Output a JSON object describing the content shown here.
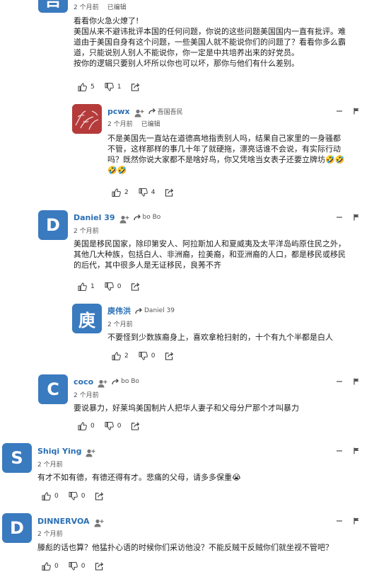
{
  "comments": [
    {
      "avatar_letter": "吾",
      "time": "2 个月前",
      "edited": "已编辑",
      "lines": [
        "看看你火急火燎了!",
        "美国从来不避讳批评本国的任何问题，你说的这些问题美国国内一直有批评。难",
        "道由于美国自身有这个问题，一些美国人就不能说你们的问题了？看看你多么霸",
        "道，只能说别人别人不能说你，你一定是中共培养出来的好党员。",
        "按你的逻辑只要别人坏所以你也可以坏，那你与他们有什么差别。"
      ],
      "likes": "5",
      "dislikes": "1"
    },
    {
      "author": "pcwx",
      "reply_to": "吾国吾民",
      "time": "2 个月前",
      "edited": "已编辑",
      "lines": [
        "不是美国先一直站在道德高地指责别人吗，结果自己家里的一身骚都",
        "不管，这样那样的事几十年了就硬拖，漂亮话谁不会说，有实际行动",
        "吗？既然你说大家都不是啥好鸟，你又凭啥当女表子还要立牌坊🤣🤣",
        "🤣🤣"
      ],
      "likes": "2",
      "dislikes": "4"
    },
    {
      "avatar_letter": "D",
      "author": "Daniel 39",
      "reply_to": "bo Bo",
      "time": "2 个月前",
      "lines": [
        "美国是移民国家，除印第安人、阿拉斯加人和夏威夷及太平洋岛屿原住民之外，",
        "其他几大种族，包括白人、非洲裔，拉美裔，和亚洲裔的人口，都是移民或移民",
        "的后代，其中很多人是无证移民，良莠不齐"
      ],
      "likes": "1",
      "dislikes": "0"
    },
    {
      "avatar_letter": "庾",
      "author": "庾伟洪",
      "reply_to": "Daniel 39",
      "time": "2 个月前",
      "lines": [
        "不要怪到少数族裔身上，喜欢拿枪扫射的，十个有九个半都是白人"
      ],
      "likes": "2",
      "dislikes": "0"
    },
    {
      "avatar_letter": "C",
      "author": "coco",
      "reply_to": "bo Bo",
      "time": "2 个月前",
      "lines": [
        "要说暴力，好莱坞美国制片人把华人妻子和父母分尸那个才叫暴力"
      ],
      "likes": "0",
      "dislikes": "0"
    },
    {
      "avatar_letter": "S",
      "author": "Shiqi Ying",
      "time": "2 个月前",
      "lines": [
        "有才不如有德，有德还得有才。悲痛的父母，请多多保重😭"
      ],
      "likes": "0",
      "dislikes": "0"
    },
    {
      "avatar_letter": "D",
      "author": "DINNERVOA",
      "time": "2 个月前",
      "lines": [
        "滕彪的话也算？他猛扑心语的时候你们采访他没？不能反贼干反贼你们就坐视不管吧？"
      ],
      "likes": "0",
      "dislikes": "0"
    }
  ],
  "colors": {
    "avatar_blue": "#3a7abf",
    "author_blue": "#2a6fb5"
  },
  "icons": {
    "like": "thumb-up-icon",
    "dislike": "thumb-down-icon",
    "share": "share-icon",
    "follow": "follow-user-icon",
    "reply": "reply-arrow-icon",
    "minimize": "minimize-icon",
    "flag": "flag-icon"
  }
}
